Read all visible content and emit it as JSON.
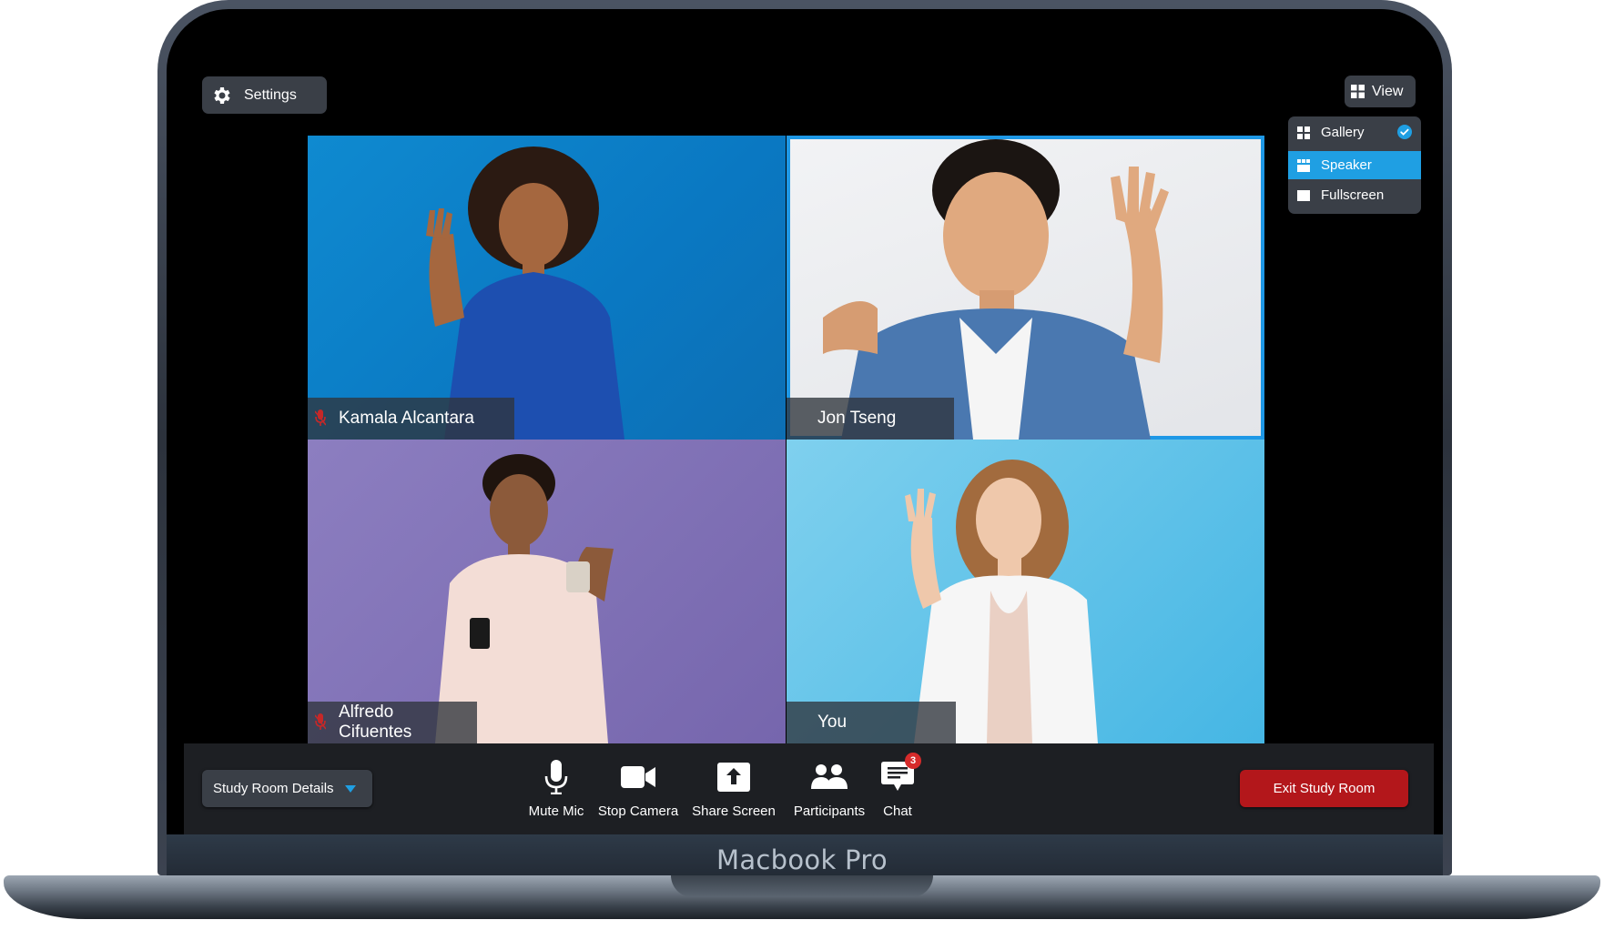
{
  "device": {
    "brand_label": "Macbook Pro"
  },
  "top_bar": {
    "settings_label": "Settings",
    "view_label": "View"
  },
  "view_menu": {
    "items": [
      {
        "label": "Gallery",
        "checked": true,
        "icon": "grid-icon"
      },
      {
        "label": "Speaker",
        "selected": true,
        "icon": "speaker-layout-icon"
      },
      {
        "label": "Fullscreen",
        "icon": "fullscreen-icon"
      }
    ]
  },
  "participants": [
    {
      "name": "Kamala Alcantara",
      "muted": true
    },
    {
      "name": "Jon Tseng",
      "muted": false,
      "active_speaker": true
    },
    {
      "name": "Alfredo Cifuentes",
      "muted": true
    },
    {
      "name": "You",
      "muted": false
    }
  ],
  "toolbar": {
    "details_label": "Study Room Details",
    "controls": [
      {
        "label": "Mute Mic",
        "icon": "microphone-icon"
      },
      {
        "label": "Stop Camera",
        "icon": "camera-icon"
      },
      {
        "label": "Share Screen",
        "icon": "share-screen-icon"
      },
      {
        "label": "Participants",
        "icon": "participants-icon"
      },
      {
        "label": "Chat",
        "icon": "chat-icon",
        "badge": "3"
      }
    ],
    "exit_label": "Exit Study Room"
  },
  "colors": {
    "accent": "#1f9fe3",
    "danger": "#b3171b",
    "muted_mic": "#c62828"
  }
}
